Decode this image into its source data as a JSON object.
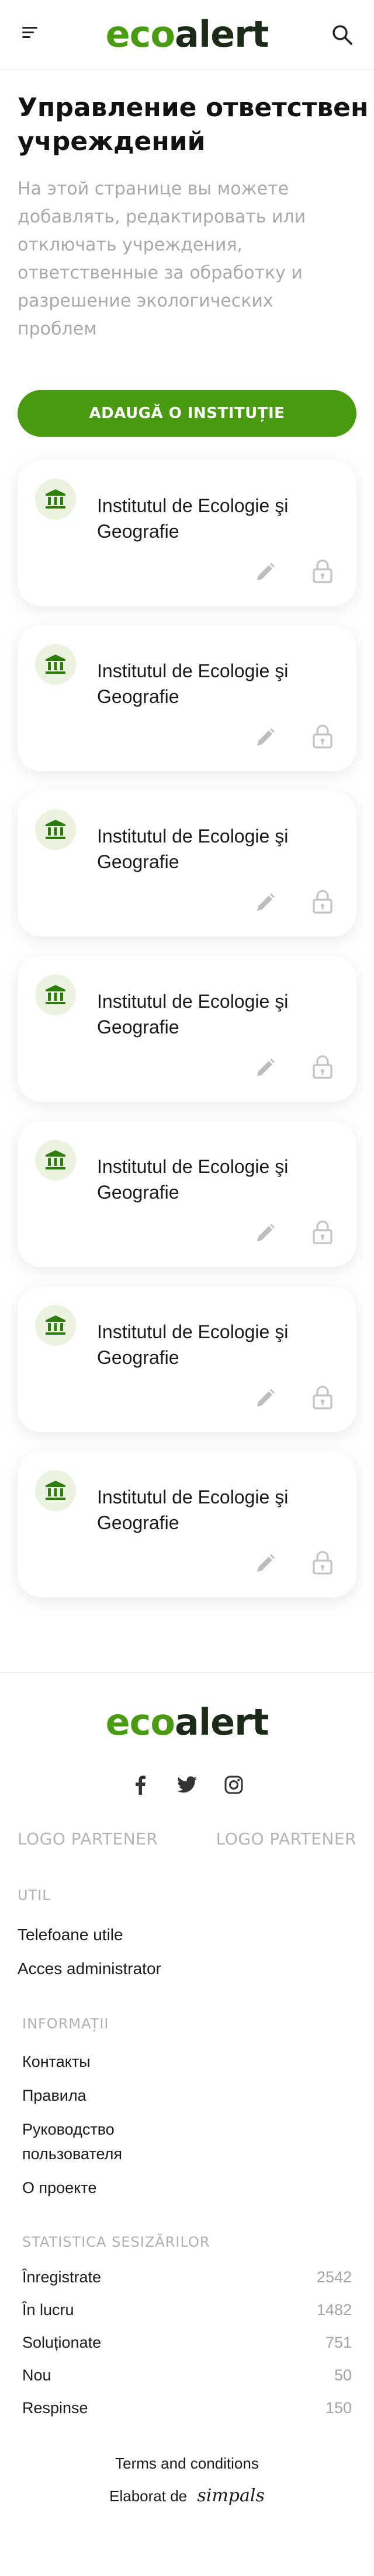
{
  "header": {
    "logo_eco": "eco",
    "logo_alert": "alert"
  },
  "page": {
    "title_line1": "Управление ответствен",
    "title_line2": "учреждений",
    "description": "На этой странице вы можете добавлять, редактировать или отключать учреждения, ответственные за обработку и разрешение экологических проблем",
    "add_button": "ADAUGĂ O INSTITUȚIE"
  },
  "institutions": [
    {
      "name": "Institutul de Ecologie şi Geografie"
    },
    {
      "name": "Institutul de Ecologie şi Geografie"
    },
    {
      "name": "Institutul de Ecologie şi Geografie"
    },
    {
      "name": "Institutul de Ecologie şi Geografie"
    },
    {
      "name": "Institutul de Ecologie şi Geografie"
    },
    {
      "name": "Institutul de Ecologie şi Geografie"
    },
    {
      "name": "Institutul de Ecologie şi Geografie"
    }
  ],
  "icons": {
    "institution": "bank-building-icon",
    "edit": "pencil-icon",
    "lock": "lock-icon",
    "menu": "hamburger-menu-icon",
    "search": "search-icon"
  },
  "colors": {
    "brand_green": "#4a9a12",
    "brand_dark": "#1b2b17",
    "icon_bg": "#e9f3df",
    "muted": "#a9a9a9"
  },
  "footer": {
    "logo_eco": "eco",
    "logo_alert": "alert",
    "socials": [
      "facebook-icon",
      "twitter-icon",
      "instagram-icon"
    ],
    "partners": [
      "LOGO PARTENER",
      "LOGO PARTENER"
    ],
    "util": {
      "title": "UTIL",
      "links": [
        "Telefoane utile",
        "Acces administrator"
      ]
    },
    "info": {
      "title": "INFORMAȚII",
      "links": [
        "Контакты",
        "Правила",
        "Руководство пользователя",
        "О проекте"
      ]
    },
    "stats": {
      "title": "STATISTICA SESIZĂRILOR",
      "rows": [
        {
          "label": "Înregistrate",
          "value": "2542"
        },
        {
          "label": "În lucru",
          "value": "1482"
        },
        {
          "label": "Soluționate",
          "value": "751"
        },
        {
          "label": "Nou",
          "value": "50"
        },
        {
          "label": "Respinse",
          "value": "150"
        }
      ]
    },
    "terms": "Terms and conditions",
    "credit_prefix": "Elaborat de",
    "credit_brand": "simpals"
  }
}
